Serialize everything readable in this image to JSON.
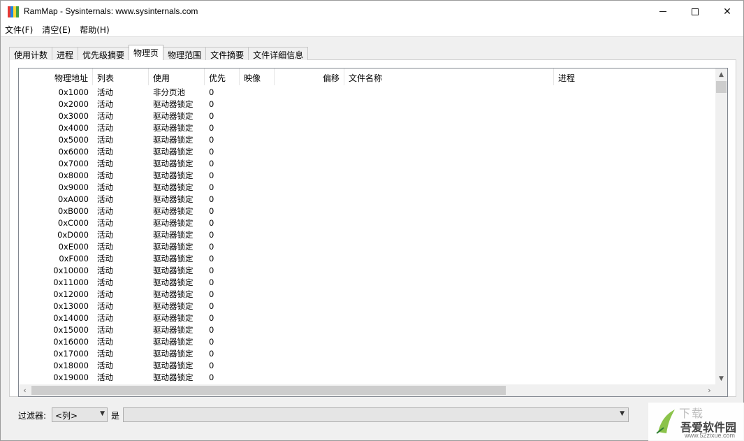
{
  "window": {
    "title": "RamMap - Sysinternals: www.sysinternals.com",
    "icon_colors": [
      "#e53935",
      "#1e88e5",
      "#fdd835",
      "#43a047"
    ]
  },
  "menu": [
    "文件(F)",
    "清空(E)",
    "帮助(H)"
  ],
  "tabs": [
    {
      "label": "使用计数",
      "active": false
    },
    {
      "label": "进程",
      "active": false
    },
    {
      "label": "优先级摘要",
      "active": false
    },
    {
      "label": "物理页",
      "active": true
    },
    {
      "label": "物理范围",
      "active": false
    },
    {
      "label": "文件摘要",
      "active": false
    },
    {
      "label": "文件详细信息",
      "active": false
    }
  ],
  "table": {
    "columns": [
      "物理地址",
      "列表",
      "使用",
      "优先",
      "映像",
      "偏移",
      "文件名称",
      "进程"
    ],
    "rows": [
      [
        "0x1000",
        "活动",
        "非分页池",
        "0"
      ],
      [
        "0x2000",
        "活动",
        "驱动器锁定",
        "0"
      ],
      [
        "0x3000",
        "活动",
        "驱动器锁定",
        "0"
      ],
      [
        "0x4000",
        "活动",
        "驱动器锁定",
        "0"
      ],
      [
        "0x5000",
        "活动",
        "驱动器锁定",
        "0"
      ],
      [
        "0x6000",
        "活动",
        "驱动器锁定",
        "0"
      ],
      [
        "0x7000",
        "活动",
        "驱动器锁定",
        "0"
      ],
      [
        "0x8000",
        "活动",
        "驱动器锁定",
        "0"
      ],
      [
        "0x9000",
        "活动",
        "驱动器锁定",
        "0"
      ],
      [
        "0xA000",
        "活动",
        "驱动器锁定",
        "0"
      ],
      [
        "0xB000",
        "活动",
        "驱动器锁定",
        "0"
      ],
      [
        "0xC000",
        "活动",
        "驱动器锁定",
        "0"
      ],
      [
        "0xD000",
        "活动",
        "驱动器锁定",
        "0"
      ],
      [
        "0xE000",
        "活动",
        "驱动器锁定",
        "0"
      ],
      [
        "0xF000",
        "活动",
        "驱动器锁定",
        "0"
      ],
      [
        "0x10000",
        "活动",
        "驱动器锁定",
        "0"
      ],
      [
        "0x11000",
        "活动",
        "驱动器锁定",
        "0"
      ],
      [
        "0x12000",
        "活动",
        "驱动器锁定",
        "0"
      ],
      [
        "0x13000",
        "活动",
        "驱动器锁定",
        "0"
      ],
      [
        "0x14000",
        "活动",
        "驱动器锁定",
        "0"
      ],
      [
        "0x15000",
        "活动",
        "驱动器锁定",
        "0"
      ],
      [
        "0x16000",
        "活动",
        "驱动器锁定",
        "0"
      ],
      [
        "0x17000",
        "活动",
        "驱动器锁定",
        "0"
      ],
      [
        "0x18000",
        "活动",
        "驱动器锁定",
        "0"
      ],
      [
        "0x19000",
        "活动",
        "驱动器锁定",
        "0"
      ]
    ]
  },
  "filter": {
    "label": "过滤器:",
    "column_value": "<列>",
    "is_label": "是",
    "value": ""
  },
  "watermark": {
    "top_text": "下载",
    "name": "吾爱软件园",
    "url": "www.52zixue.com"
  }
}
